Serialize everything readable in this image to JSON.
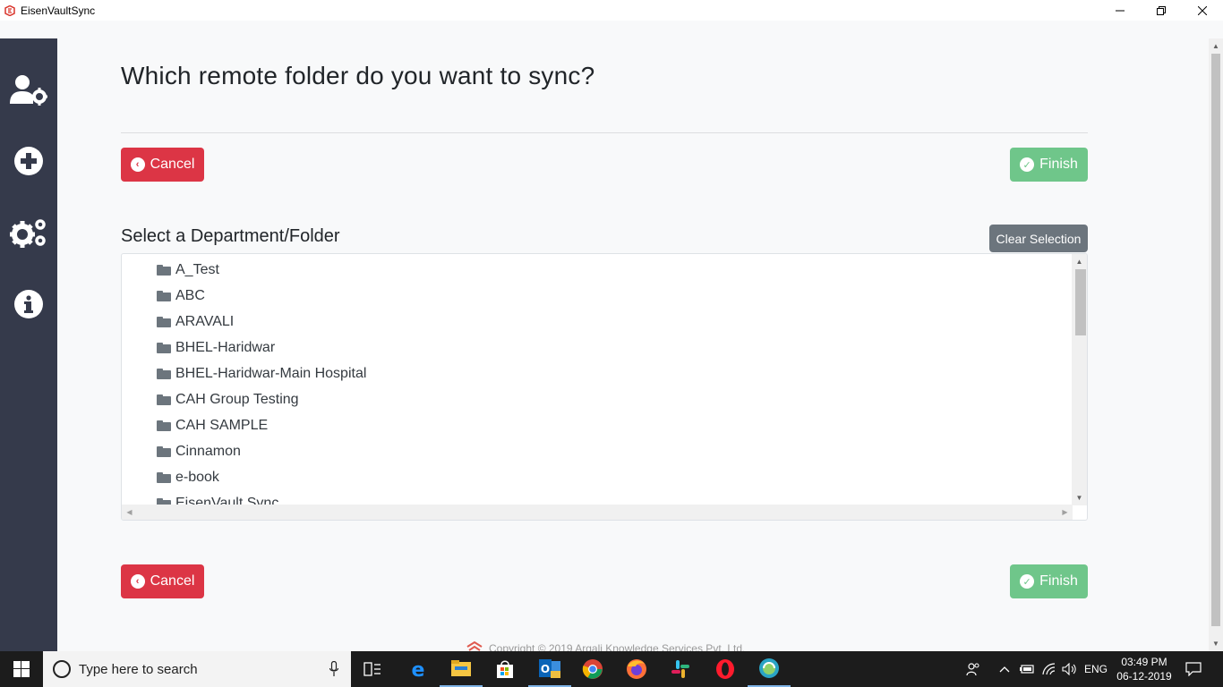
{
  "window": {
    "title": "EisenVaultSync",
    "controls": [
      "minimize",
      "restore",
      "close"
    ]
  },
  "sidebar": {
    "items": [
      {
        "icon": "user-settings-icon"
      },
      {
        "icon": "plus-circle-icon"
      },
      {
        "icon": "cogs-icon"
      },
      {
        "icon": "info-circle-icon"
      }
    ]
  },
  "page": {
    "title": "Which remote folder do you want to sync?",
    "cancel_label": "Cancel",
    "finish_label": "Finish",
    "section_label": "Select a Department/Folder",
    "clear_selection_label": "Clear Selection"
  },
  "folders": [
    "A_Test",
    "ABC",
    "ARAVALI",
    "BHEL-Haridwar",
    "BHEL-Haridwar-Main Hospital",
    "CAH Group Testing",
    "CAH SAMPLE",
    "Cinnamon",
    "e-book",
    "EisenVault Sync"
  ],
  "footer": {
    "text": "Copyright © 2019 Argali Knowledge Services Pvt. Ltd."
  },
  "taskbar": {
    "search_placeholder": "Type here to search",
    "apps": [
      "task-view",
      "edge",
      "file-explorer",
      "store",
      "outlook",
      "chrome",
      "firefox",
      "slack",
      "opera",
      "eisenvault-sync"
    ],
    "language": "ENG",
    "time": "03:49 PM",
    "date": "06-12-2019"
  },
  "colors": {
    "sidebar": "#353a4b",
    "danger": "#dc3545",
    "success": "#6fc68a",
    "secondary": "#6c757d"
  }
}
